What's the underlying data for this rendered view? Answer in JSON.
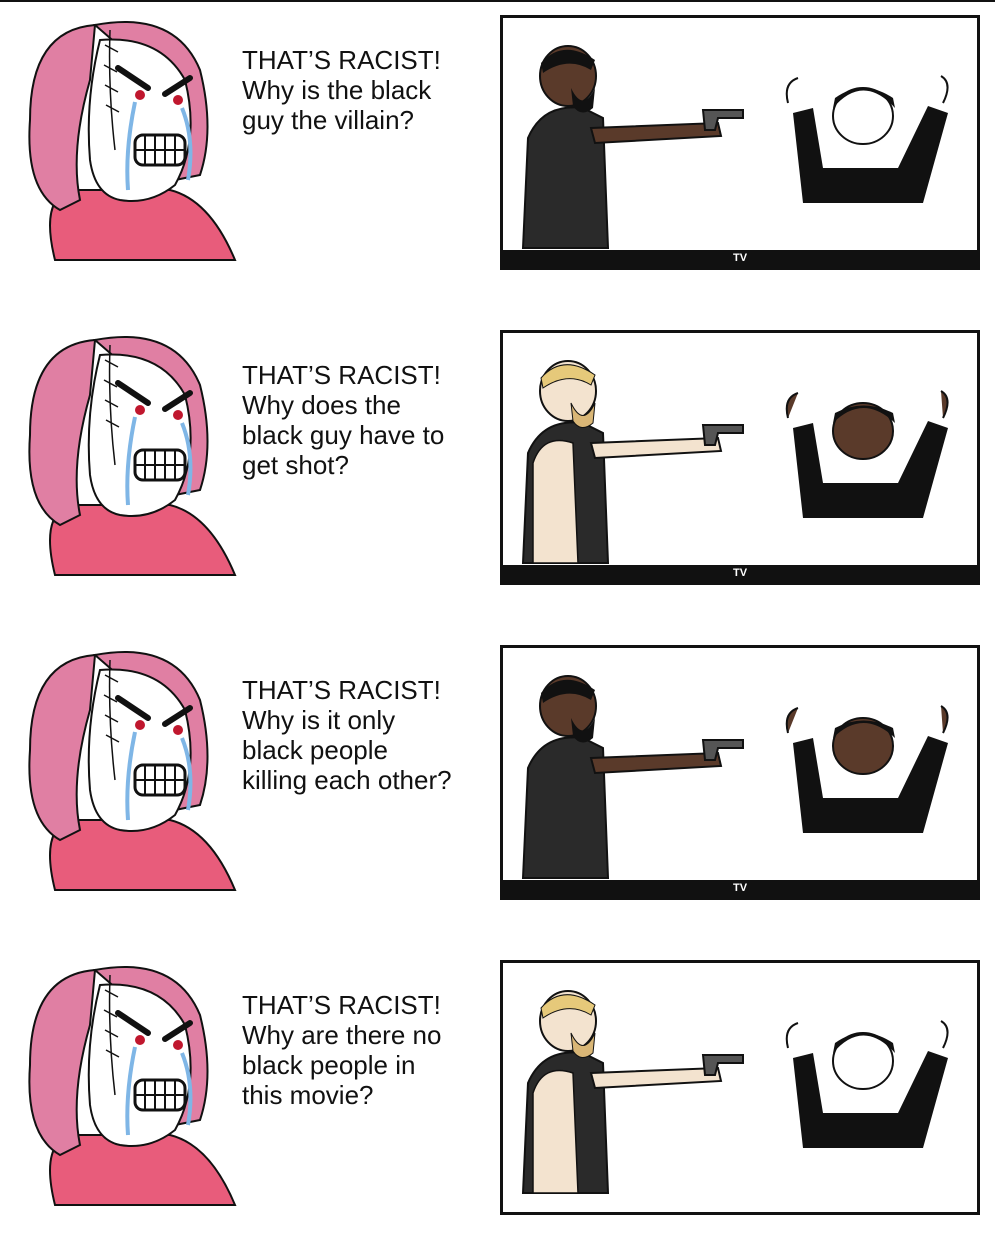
{
  "panels": [
    {
      "caption": [
        "THAT’S RACIST!",
        "Why is the black",
        "guy the villain?"
      ],
      "tv_label": "TV",
      "shooter_skin": "#5a3a2a",
      "target_skin": "#ffffff",
      "shooter_type": "dark",
      "target_type": "wojak"
    },
    {
      "caption": [
        "THAT’S RACIST!",
        "Why does the",
        "black guy have to",
        "get shot?"
      ],
      "tv_label": "TV",
      "shooter_skin": "#f3e3cf",
      "target_skin": "#5a3a2a",
      "shooter_type": "light",
      "target_type": "dark"
    },
    {
      "caption": [
        "THAT’S RACIST!",
        "Why is it only",
        "black people",
        "killing each other?"
      ],
      "tv_label": "TV",
      "shooter_skin": "#5a3a2a",
      "target_skin": "#5a3a2a",
      "shooter_type": "dark",
      "target_type": "dark"
    },
    {
      "caption": [
        "THAT’S RACIST!",
        "Why are there no",
        "black people in",
        "this movie?"
      ],
      "tv_label": "TV",
      "shooter_skin": "#f3e3cf",
      "target_skin": "#ffffff",
      "shooter_type": "light",
      "target_type": "wojak"
    }
  ],
  "colors": {
    "hair": "#e07fa3",
    "shirt": "#e85c7b",
    "tears": "#7fb6e6",
    "ink": "#111111"
  }
}
